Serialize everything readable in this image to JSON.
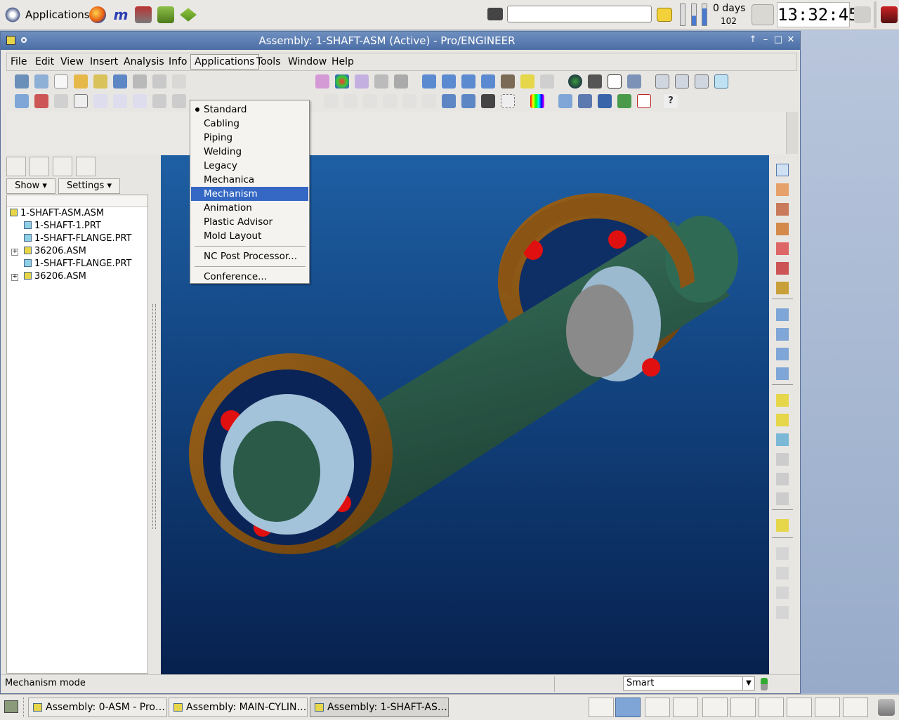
{
  "top_panel": {
    "applications_label": "Applications",
    "search_value": "",
    "uptime_days": "0 days",
    "uptime_sub": "102",
    "clock": "13:32:45"
  },
  "window": {
    "title": "Assembly: 1-SHAFT-ASM (Active) - Pro/ENGINEER",
    "menu": [
      "File",
      "Edit",
      "View",
      "Insert",
      "Analysis",
      "Info",
      "Applications",
      "Tools",
      "Window",
      "Help"
    ]
  },
  "applications_menu": {
    "items": [
      {
        "label": "Standard",
        "checked": true
      },
      {
        "label": "Cabling"
      },
      {
        "label": "Piping"
      },
      {
        "label": "Welding"
      },
      {
        "label": "Legacy"
      },
      {
        "label": "Mechanica"
      },
      {
        "label": "Mechanism",
        "selected": true
      },
      {
        "label": "Animation"
      },
      {
        "label": "Plastic Advisor"
      },
      {
        "label": "Mold Layout"
      },
      {
        "label": "NC Post Processor..."
      },
      {
        "label": "Conference..."
      }
    ]
  },
  "left_panel": {
    "show_label": "Show",
    "settings_label": "Settings",
    "tree": [
      {
        "label": "1-SHAFT-ASM.ASM",
        "type": "asm",
        "level": 0
      },
      {
        "label": "1-SHAFT-1.PRT",
        "type": "prt",
        "level": 1
      },
      {
        "label": "1-SHAFT-FLANGE.PRT",
        "type": "prt",
        "level": 1
      },
      {
        "label": "36206.ASM",
        "type": "asm",
        "level": 1,
        "expandable": true
      },
      {
        "label": "1-SHAFT-FLANGE.PRT",
        "type": "prt",
        "level": 1
      },
      {
        "label": "36206.ASM",
        "type": "asm",
        "level": 1,
        "expandable": true
      }
    ]
  },
  "status": {
    "message": "Mechanism mode",
    "filter_value": "Smart"
  },
  "taskbar": {
    "tasks": [
      {
        "label": "Assembly: 0-ASM - Pro…"
      },
      {
        "label": "Assembly: MAIN-CYLIN…"
      },
      {
        "label": "Assembly: 1-SHAFT-AS…",
        "active": true
      }
    ]
  },
  "colors": {
    "viewport_top": "#1e5fa3",
    "viewport_bottom": "#07214e",
    "shaft": "#2f5e4c",
    "bearing_outer": "#7a4c12",
    "bearing_inner": "#a9c8de",
    "balls": "#d81010",
    "menu_highlight": "#3568c4"
  }
}
